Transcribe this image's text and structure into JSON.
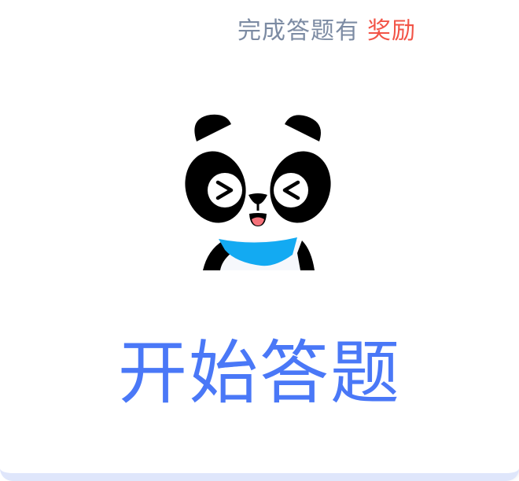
{
  "reward": {
    "prefix": "完成答题有",
    "highlight": "奖励"
  },
  "mascot": {
    "icon": "panda-mascot-icon"
  },
  "start_button": {
    "label": "开始答题"
  },
  "colors": {
    "accent": "#4a78f7",
    "highlight": "#f25447",
    "muted_text": "#7c8ba3",
    "scarf": "#13aaf2"
  }
}
